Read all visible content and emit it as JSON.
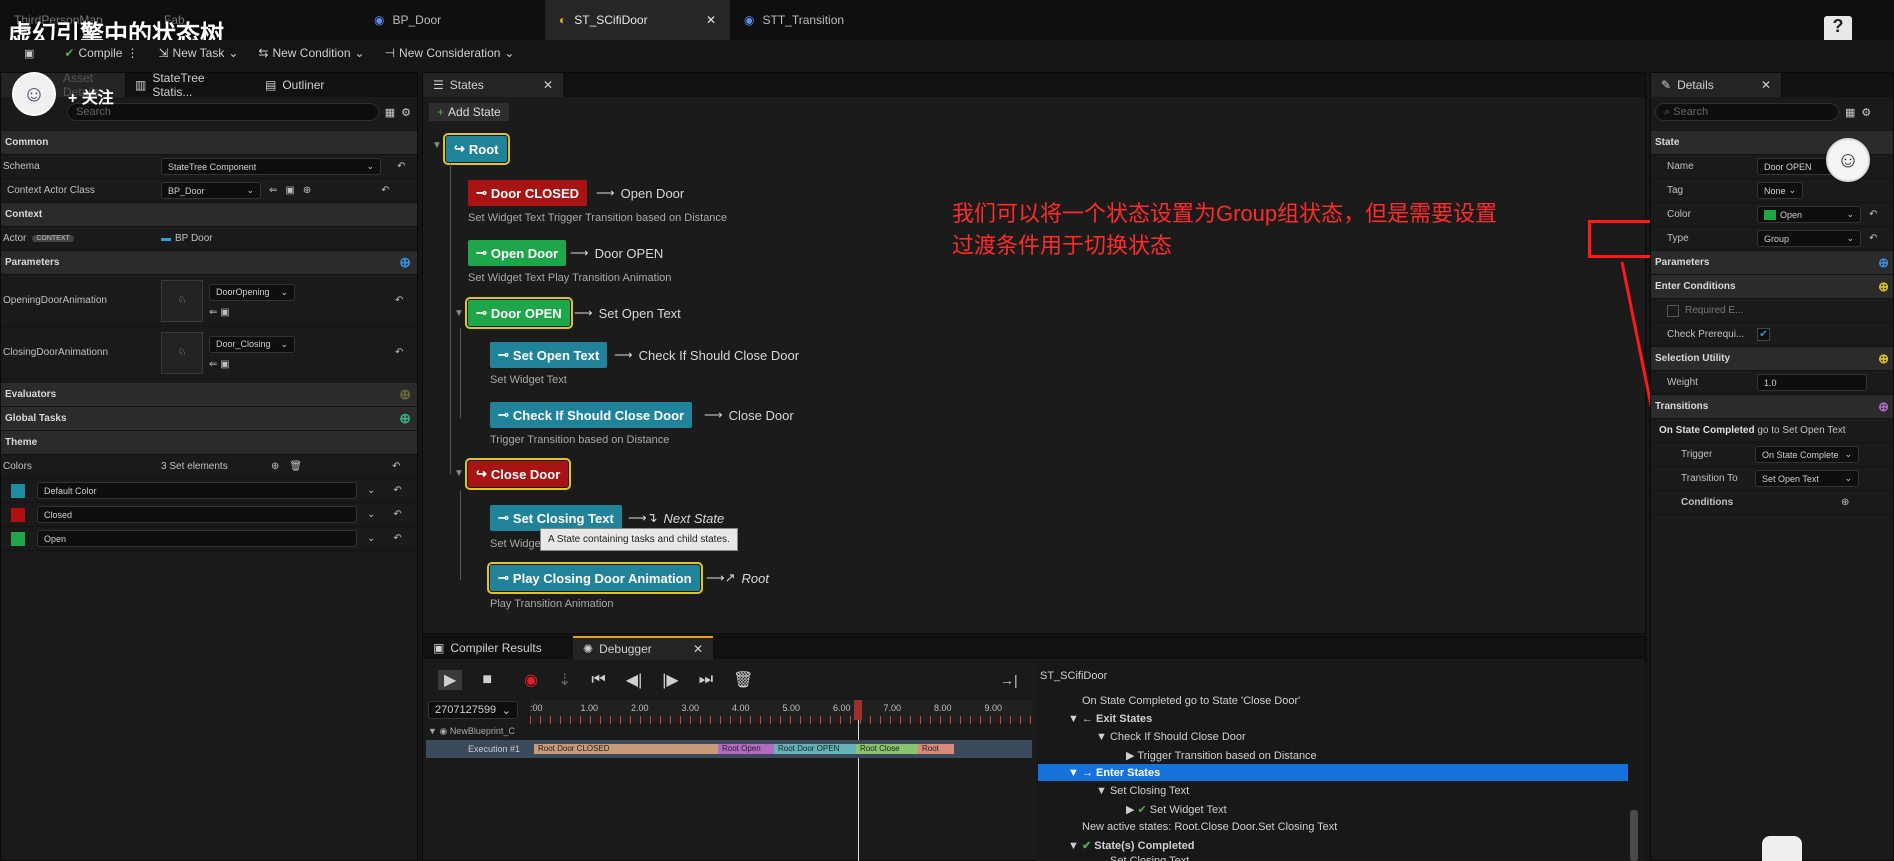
{
  "overlay": {
    "title": "虚幻引擎中的状态树",
    "follow": "+ 关注",
    "help": "?"
  },
  "tabs": [
    {
      "label": "ThirdPersonMap"
    },
    {
      "label": "Fab"
    },
    {
      "label": "BP_Door"
    },
    {
      "label": "ST_SCifiDoor"
    },
    {
      "label": "STT_Transition"
    }
  ],
  "toolbar": {
    "compile": "Compile",
    "new_task": "New Task",
    "new_condition": "New Condition",
    "new_consideration": "New Consideration"
  },
  "left": {
    "tabs": [
      "Asset Details",
      "StateTree Statis...",
      "Outliner"
    ],
    "search_placeholder": "Search",
    "common": "Common",
    "schema_label": "Schema",
    "schema_value": "StateTree Component",
    "ctx_actor_label": "Context Actor Class",
    "ctx_actor_value": "BP_Door",
    "context": "Context",
    "actor_label": "Actor",
    "actor_badge": "CONTEXT",
    "actor_value": "BP Door",
    "parameters": "Parameters",
    "param1_label": "OpeningDoorAnimation",
    "param1_value": "DoorOpening",
    "param2_label": "ClosingDoorAnimationn",
    "param2_value": "Door_Closing",
    "evaluators": "Evaluators",
    "global_tasks": "Global Tasks",
    "theme": "Theme",
    "colors_label": "Colors",
    "colors_count": "3 Set elements",
    "colors": [
      {
        "name": "Default Color",
        "hex": "#1f8ca0"
      },
      {
        "name": "Closed",
        "hex": "#b01010"
      },
      {
        "name": "Open",
        "hex": "#21a548"
      }
    ]
  },
  "states_panel": {
    "tab": "States",
    "add_state": "Add State",
    "root": "Root",
    "door_closed": "Door CLOSED",
    "door_closed_next": "Open Door",
    "door_closed_sub": "Set Widget Text   Trigger Transition based on Distance",
    "open_door": "Open Door",
    "open_door_next": "Door OPEN",
    "open_door_sub": "Set Widget Text   Play Transition Animation",
    "door_open": "Door OPEN",
    "door_open_next": "Set Open Text",
    "set_open_text": "Set Open Text",
    "set_open_text_next": "Check If Should Close Door",
    "set_open_text_sub": "Set Widget Text",
    "check_close": "Check If Should Close Door",
    "check_close_next": "Close Door",
    "check_close_sub": "Trigger Transition based on Distance",
    "close_door": "Close Door",
    "set_closing": "Set Closing Text",
    "set_closing_next": "Next State",
    "set_closing_sub": "Set Widget Text",
    "tooltip": "A State containing tasks and child states.",
    "play_closing": "Play Closing Door Animation",
    "play_closing_next": "Root",
    "play_closing_sub": "Play Transition Animation"
  },
  "annotation": {
    "line1": "我们可以将一个状态设置为Group组状态，但是需要设置",
    "line2": "过渡条件用于切换状态"
  },
  "details": {
    "tab": "Details",
    "search_placeholder": "Search",
    "state_section": "State",
    "name_label": "Name",
    "name_value": "Door OPEN",
    "tag_label": "Tag",
    "tag_value": "None",
    "color_label": "Color",
    "color_value": "Open",
    "type_label": "Type",
    "type_value": "Group",
    "parameters": "Parameters",
    "enter_conditions": "Enter Conditions",
    "required_label": "Required E...",
    "check_prereq": "Check Prerequi...",
    "selection_utility": "Selection Utility",
    "weight_label": "Weight",
    "weight_value": "1.0",
    "transitions": "Transitions",
    "transition_head_bold": "On State Completed",
    "transition_head_rest": "go to Set Open Text",
    "trigger_label": "Trigger",
    "trigger_value": "On State Complete",
    "transition_to_label": "Transition To",
    "transition_to_value": "Set Open Text",
    "conditions_label": "Conditions"
  },
  "bottom": {
    "tab_compiler": "Compiler Results",
    "tab_debugger": "Debugger",
    "id_value": "2707127599",
    "ticks": [
      ":00",
      "1.00",
      "2.00",
      "3.00",
      "4.00",
      "5.00",
      "6.00",
      "7.00",
      "8.00",
      "9.00"
    ],
    "track1": "NewBlueprint_C",
    "track2": "Execution #1",
    "segments": [
      {
        "label": "Root Door CLOSED",
        "color": "#c79a7a"
      },
      {
        "label": "Root Open",
        "color": "#b36ac2"
      },
      {
        "label": "Root Door OPEN",
        "color": "#64b2b8"
      },
      {
        "label": "Root Close",
        "color": "#8ac46e"
      },
      {
        "label": "Root",
        "color": "#d88a7a"
      }
    ],
    "asset": "ST_SCifiDoor",
    "log": [
      "On State Completed go to State 'Close Door'",
      "Exit States",
      "Check If Should Close Door",
      "Trigger Transition based on Distance",
      "Enter States",
      "Set Closing Text",
      "Set Widget Text",
      "New active states: Root.Close Door.Set Closing Text",
      "State(s) Completed",
      "Set Closing Text"
    ]
  }
}
